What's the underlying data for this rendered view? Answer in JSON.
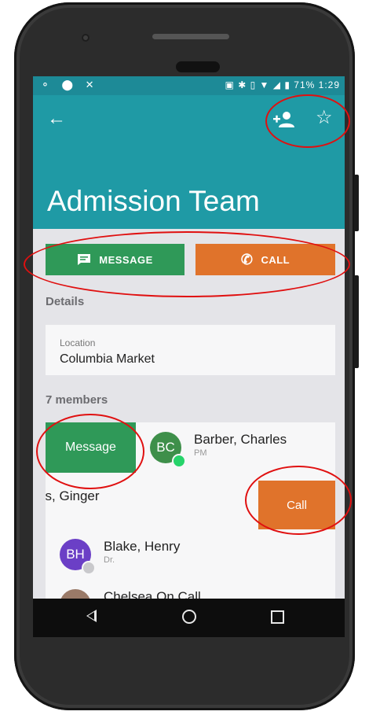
{
  "status_bar": {
    "left_icons": "⚬ ⬤ ✕",
    "battery": "71%",
    "time": "1:29"
  },
  "app_bar": {
    "title": "Admission Team",
    "back_icon": "arrow-left",
    "add_member_icon": "person-add",
    "favorite_icon": "star-outline"
  },
  "actions": {
    "message_label": "MESSAGE",
    "call_label": "CALL"
  },
  "details": {
    "heading": "Details",
    "location_label": "Location",
    "location_value": "Columbia Market"
  },
  "members": {
    "heading": "7 members",
    "swipe_message_label": "Message",
    "swipe_call_label": "Call",
    "list": [
      {
        "initials": "BC",
        "name": "Barber, Charles",
        "subtitle": "PM",
        "avatar_color": "#3e8f4a",
        "presence": "online"
      },
      {
        "initials": "",
        "name": "yliss, Ginger",
        "subtitle": "",
        "avatar_color": "",
        "presence": ""
      },
      {
        "initials": "BH",
        "name": "Blake, Henry",
        "subtitle": "Dr.",
        "avatar_color": "#6b3fc6",
        "presence": "away"
      },
      {
        "initials": "",
        "name": "Chelsea On Call",
        "subtitle": "",
        "avatar_color": "#9a7a68",
        "presence": ""
      }
    ]
  },
  "colors": {
    "teal": "#1f9aa5",
    "green": "#2f9958",
    "orange": "#e0732b"
  }
}
